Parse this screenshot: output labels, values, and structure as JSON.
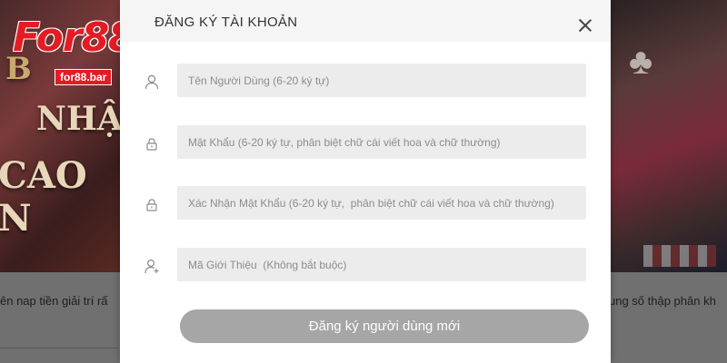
{
  "background": {
    "banner_words": [
      "B",
      "NHẬ",
      "CAO N"
    ],
    "left_text": "ên nap tiền giải trí rấ",
    "right_text": "ung số thập phân kh"
  },
  "logo": {
    "main": "For88",
    "sub": "for88.bar"
  },
  "modal": {
    "title": "ĐĂNG KÝ TÀI KHOẢN",
    "fields": {
      "username": {
        "placeholder": "Tên Người Dùng (6-20 ký tự)",
        "value": ""
      },
      "password": {
        "placeholder": "Mật Khẩu (6-20 ký tự, phân biệt chữ cái viết hoa và chữ thường)",
        "value": ""
      },
      "confirm_password": {
        "placeholder": "Xác Nhận Mật Khẩu (6-20 ký tự,  phân biệt chữ cái viết hoa và chữ thường)",
        "value": ""
      },
      "referral_code": {
        "placeholder": "Mã Giới Thiệu  (Không bắt buộc)",
        "value": ""
      }
    },
    "submit_label": "Đăng ký người dùng mới"
  },
  "icons": {
    "username": "user-icon",
    "password": "lock-icon",
    "confirm_password": "lock-icon",
    "referral_code": "user-add-icon",
    "close": "close-icon"
  },
  "colors": {
    "brand_red": "#e51b23",
    "field_bg": "#ececec",
    "button_bg": "#a6a6a6",
    "header_bg": "#f5f5f5"
  }
}
